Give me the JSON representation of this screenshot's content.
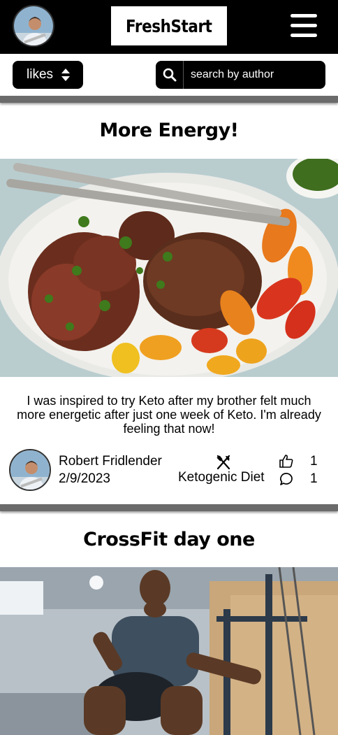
{
  "header": {
    "logo_text": "FreshStart",
    "avatar_icon": "user-avatar",
    "menu_icon": "hamburger-menu-icon"
  },
  "toolbar": {
    "sort_value": "likes",
    "sort_icon": "sort-arrows-icon",
    "search_icon": "search-icon",
    "search_placeholder": "search by author"
  },
  "posts": [
    {
      "title": "More Energy!",
      "image": "steak-and-grilled-peppers-photo",
      "text": "I was inspired to try Keto after my brother felt much more energetic after just one week of Keto. I'm already feeling that now!",
      "author": "Robert Fridlender",
      "date": "2/9/2023",
      "category": "Ketogenic Diet",
      "category_icon": "utensils-icon",
      "likes": "1",
      "comments": "1"
    },
    {
      "title": "CrossFit day one",
      "image": "crossfit-athlete-squat-photo"
    }
  ],
  "colors": {
    "header_bg": "#000000",
    "divider": "#6b6b6b",
    "background": "#ffffff"
  }
}
